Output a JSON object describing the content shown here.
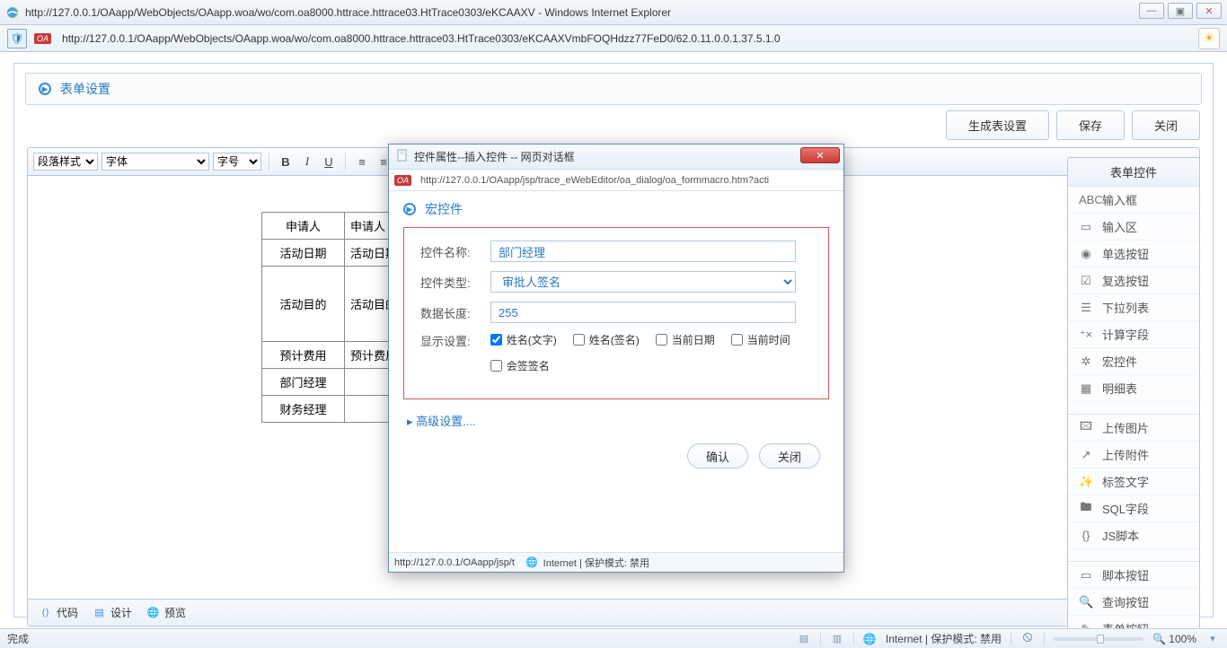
{
  "window": {
    "title": "http://127.0.0.1/OAapp/WebObjects/OAapp.woa/wo/com.oa8000.httrace.httrace03.HtTrace0303/eKCAAXV - Windows Internet Explorer",
    "address": "http://127.0.0.1/OAapp/WebObjects/OAapp.woa/wo/com.oa8000.httrace.httrace03.HtTrace0303/eKCAAXVmbFOQHdzz77FeD0/62.0.11.0.0.1.37.5.1.0"
  },
  "page": {
    "title": "表单设置",
    "actions": {
      "generate": "生成表设置",
      "save": "保存",
      "close": "关闭"
    }
  },
  "toolbar": {
    "para": "段落样式",
    "font": "字体",
    "size": "字号"
  },
  "form_table": [
    {
      "label": "申请人",
      "value": "申请人"
    },
    {
      "label": "活动日期",
      "value": "活动日期"
    },
    {
      "label": "活动目的",
      "value": "活动目的",
      "tall": true
    },
    {
      "label": "预计费用",
      "value": "预计费用"
    },
    {
      "label": "部门经理",
      "value": ""
    },
    {
      "label": "财务经理",
      "value": ""
    }
  ],
  "tabs": {
    "code": "代码",
    "design": "设计",
    "preview": "预览"
  },
  "sidebar": {
    "title": "表单控件",
    "groups": [
      [
        "输入框",
        "输入区",
        "单选按钮",
        "复选按钮",
        "下拉列表",
        "计算字段",
        "宏控件",
        "明细表"
      ],
      [
        "上传图片",
        "上传附件",
        "标签文字",
        "SQL字段",
        "JS脚本"
      ],
      [
        "脚本按钮",
        "查询按钮",
        "表单按钮"
      ]
    ],
    "icons": [
      [
        "ABC",
        "▭",
        "◉",
        "☑",
        "☰",
        "⁺×",
        "✲",
        "▦"
      ],
      [
        "🖾",
        "↗",
        "✨",
        "🖿",
        "{}"
      ],
      [
        "▭",
        "🔍",
        "✎"
      ]
    ]
  },
  "dialog": {
    "win_title": "控件属性--插入控件 -- 网页对话框",
    "address": "http://127.0.0.1/OAapp/jsp/trace_eWebEditor/oa_dialog/oa_formmacro.htm?acti",
    "section": "宏控件",
    "fields": {
      "name_lbl": "控件名称:",
      "name_val": "部门经理",
      "type_lbl": "控件类型:",
      "type_val": "审批人签名",
      "len_lbl": "数据长度:",
      "len_val": "255",
      "disp_lbl": "显示设置:"
    },
    "checks": [
      {
        "label": "姓名(文字)",
        "checked": true
      },
      {
        "label": "姓名(签名)",
        "checked": false
      },
      {
        "label": "当前日期",
        "checked": false
      },
      {
        "label": "当前时间",
        "checked": false
      },
      {
        "label": "会签签名",
        "checked": false
      }
    ],
    "advanced": "▸ 高级设置....",
    "ok": "确认",
    "cancel": "关闭",
    "status_left": "http://127.0.0.1/OAapp/jsp/t",
    "status_right": "Internet | 保护模式: 禁用"
  },
  "statusbar": {
    "done": "完成",
    "zone": "Internet | 保护模式: 禁用",
    "zoom": "100%"
  }
}
